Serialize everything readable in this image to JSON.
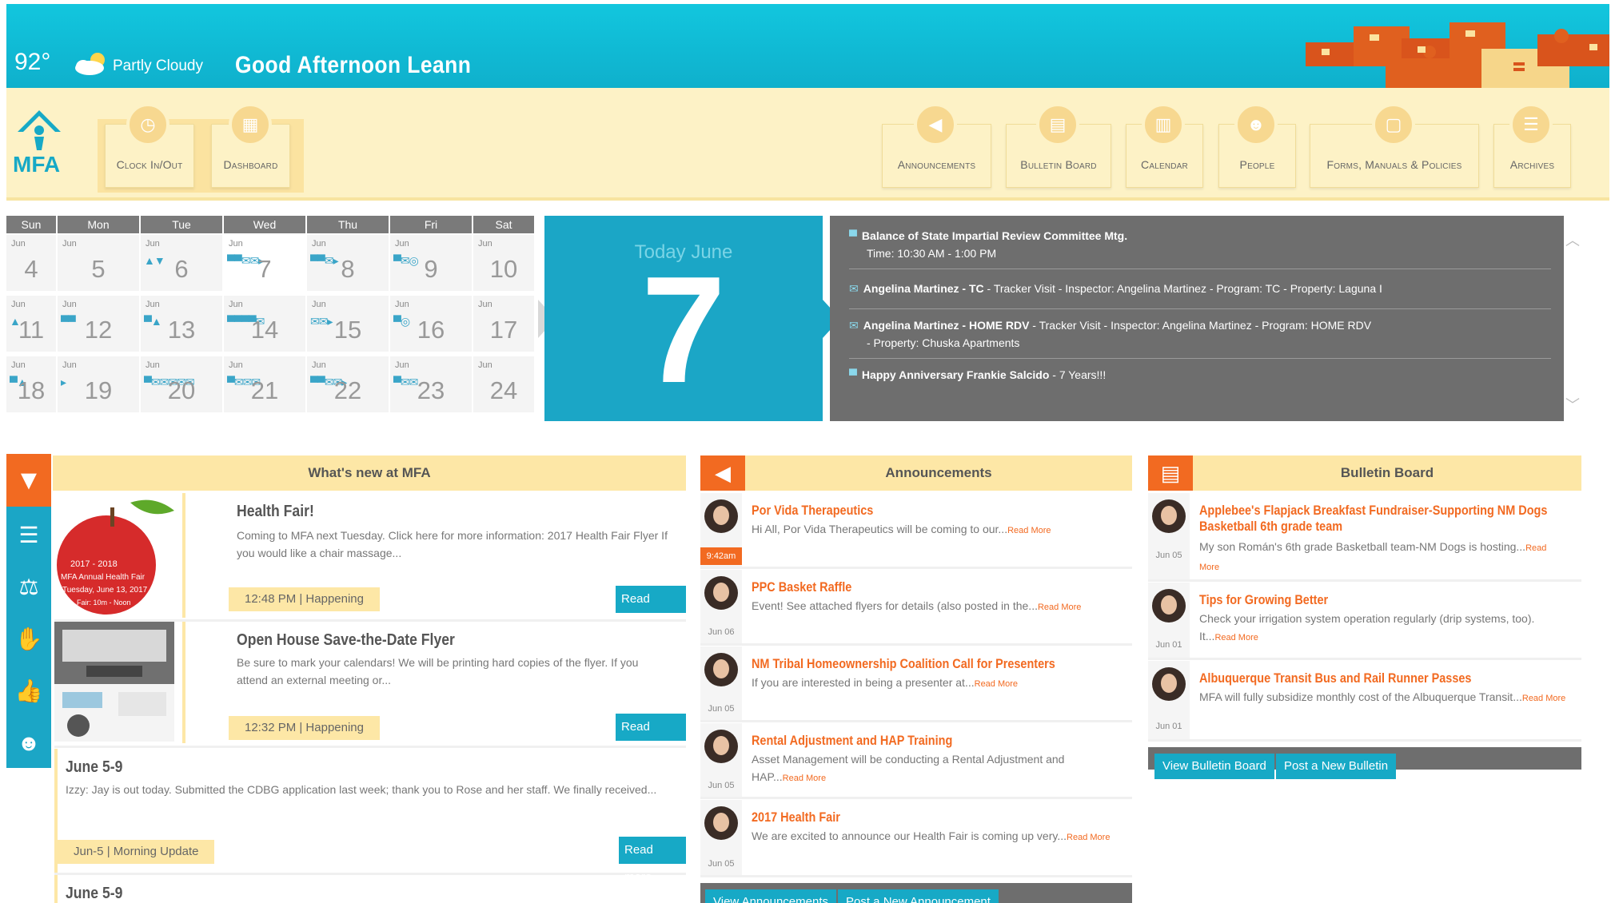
{
  "weather": {
    "temp": "92°",
    "condition": "Partly Cloudy"
  },
  "greeting": "Good Afternoon Leann",
  "logo": {
    "text": "MFA"
  },
  "nav_left": [
    {
      "label": "Clock In/Out",
      "icon": "clock-icon"
    },
    {
      "label": "Dashboard",
      "icon": "dashboard-icon"
    }
  ],
  "nav_right": [
    {
      "label": "Announcements",
      "icon": "megaphone-icon"
    },
    {
      "label": "Bulletin Board",
      "icon": "bulletin-icon"
    },
    {
      "label": "Calendar",
      "icon": "calendar-icon"
    },
    {
      "label": "People",
      "icon": "people-icon"
    },
    {
      "label": "Forms, Manuals & Policies",
      "icon": "forms-icon"
    },
    {
      "label": "Archives",
      "icon": "archives-icon"
    }
  ],
  "calendar": {
    "weekdays": [
      "Sun",
      "Mon",
      "Tue",
      "Wed",
      "Thu",
      "Fri",
      "Sat"
    ],
    "month_label": "Jun",
    "weeks": [
      [
        "4",
        "5",
        "6",
        "7",
        "8",
        "9",
        "10"
      ],
      [
        "11",
        "12",
        "13",
        "14",
        "15",
        "16",
        "17"
      ],
      [
        "18",
        "19",
        "20",
        "21",
        "22",
        "23",
        "24"
      ]
    ]
  },
  "today": {
    "label": "Today June",
    "day": "7"
  },
  "events": [
    {
      "title": "Balance of State Impartial Review Committee Mtg.",
      "detail": "Time: 10:30 AM - 1:00 PM"
    },
    {
      "title": "Angelina Martinez - TC",
      "detail": " - Tracker Visit   - Inspector: Angelina Martinez   - Program: TC   - Property: Laguna I"
    },
    {
      "title": "Angelina Martinez - HOME RDV",
      "detail": " - Tracker Visit   - Inspector: Angelina Martinez   - Program: HOME RDV",
      "detail2": "- Property: Chuska Apartments"
    },
    {
      "title": "Happy Anniversary",
      "name": "Frankie Salcido",
      "detail": " - 7 Years!!!"
    }
  ],
  "whats_new": {
    "header": "What's new at MFA",
    "thumb1": {
      "line1": "2017 - 2018",
      "line2": "MFA Annual Health Fair",
      "line3": "Tuesday, June 13, 2017",
      "line4": "Fair: 10m - Noon"
    },
    "items": [
      {
        "title": "Health Fair!",
        "text": "Coming to MFA next Tuesday. Click here for more information: 2017 Health Fair Flyer If you would like a chair massage...",
        "meta": "12:48 PM | Happening",
        "read_more": "Read more"
      },
      {
        "title": "Open House Save-the-Date Flyer",
        "text": "Be sure to mark your calendars! We will be printing hard copies of the flyer. If you attend an external meeting or...",
        "meta": "12:32 PM | Happening",
        "read_more": "Read more"
      },
      {
        "title": "June 5-9",
        "text": "Izzy:   Jay is out today. Submitted the CDBG application last week; thank you to Rose and her staff. We finally received...",
        "meta": "Jun-5 | Morning Update",
        "read_more": "Read more"
      },
      {
        "title": "June 5-9"
      }
    ]
  },
  "announcements": {
    "header": "Announcements",
    "items": [
      {
        "title": "Por Vida Therapeutics",
        "text": "Hi All, Por Vida Therapeutics will be coming to our...",
        "read_more": "Read More",
        "date": "9:42am"
      },
      {
        "title": "PPC Basket Raffle",
        "text": "Event!  See attached flyers for details (also posted in the...",
        "read_more": "Read More",
        "date": "Jun 06"
      },
      {
        "title": "NM Tribal Homeownership Coalition Call for Presenters",
        "text": "  If you are interested in being a presenter at...",
        "read_more": "Read More",
        "date": "Jun 05"
      },
      {
        "title": "Rental Adjustment and HAP Training",
        "text": "Asset Management will be conducting a Rental Adjustment and HAP...",
        "read_more": "Read More",
        "date": "Jun 05"
      },
      {
        "title": "2017 Health Fair",
        "text": "We are excited to announce our Health Fair is coming up very...",
        "read_more": "Read More",
        "date": "Jun 05"
      }
    ],
    "view_btn": "View Announcements",
    "post_btn": "Post a New Announcement"
  },
  "bulletin": {
    "header": "Bulletin Board",
    "items": [
      {
        "title": "Applebee's Flapjack Breakfast Fundraiser-Supporting NM Dogs Basketball 6th grade team",
        "text": "My son Román's 6th grade Basketball team-NM Dogs is hosting...",
        "read_more": "Read More",
        "date": "Jun 05"
      },
      {
        "title": "Tips for Growing Better",
        "text": "Check your irrigation system operation regularly (drip systems, too). It...",
        "read_more": "Read More",
        "date": "Jun 01"
      },
      {
        "title": "Albuquerque Transit Bus and Rail Runner Passes",
        "text": "MFA will fully subsidize monthly cost of the Albuquerque Transit...",
        "read_more": "Read More",
        "date": "Jun 01"
      }
    ],
    "view_btn": "View Bulletin Board",
    "post_btn": "Post a New Bulletin"
  },
  "colors": {
    "primary": "#1ba6c6",
    "accent": "#f26a21",
    "nav_bg": "#fdf2c6",
    "header_bg": "#fde7a6",
    "dark": "#6e6e6e"
  }
}
